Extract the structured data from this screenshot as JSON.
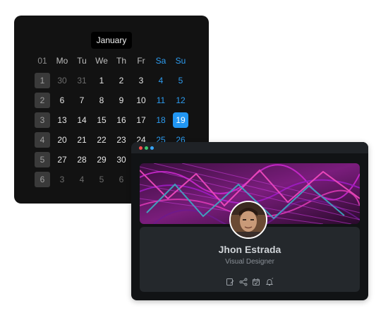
{
  "calendar": {
    "month": "January",
    "header": [
      "01",
      "Mo",
      "Tu",
      "We",
      "Th",
      "Fr",
      "Sa",
      "Su"
    ],
    "rows": [
      [
        "1",
        "30",
        "31",
        "1",
        "2",
        "3",
        "4",
        "5"
      ],
      [
        "2",
        "6",
        "7",
        "8",
        "9",
        "10",
        "11",
        "12"
      ],
      [
        "3",
        "13",
        "14",
        "15",
        "16",
        "17",
        "18",
        "19"
      ],
      [
        "4",
        "20",
        "21",
        "22",
        "23",
        "24",
        "25",
        "26"
      ],
      [
        "5",
        "27",
        "28",
        "29",
        "30",
        "",
        "",
        ""
      ],
      [
        "6",
        "3",
        "4",
        "5",
        "6",
        "",
        "",
        ""
      ]
    ],
    "selected_day": "19"
  },
  "profile": {
    "name": "Jhon Estrada",
    "role": "Visual Designer",
    "actions": [
      "edit-icon",
      "share-icon",
      "calendar-check-icon",
      "bell-icon"
    ]
  },
  "colors": {
    "accent": "#2196f3",
    "calendar_bg": "#121212",
    "window_bg": "#111315",
    "card_bg": "#24282c"
  }
}
